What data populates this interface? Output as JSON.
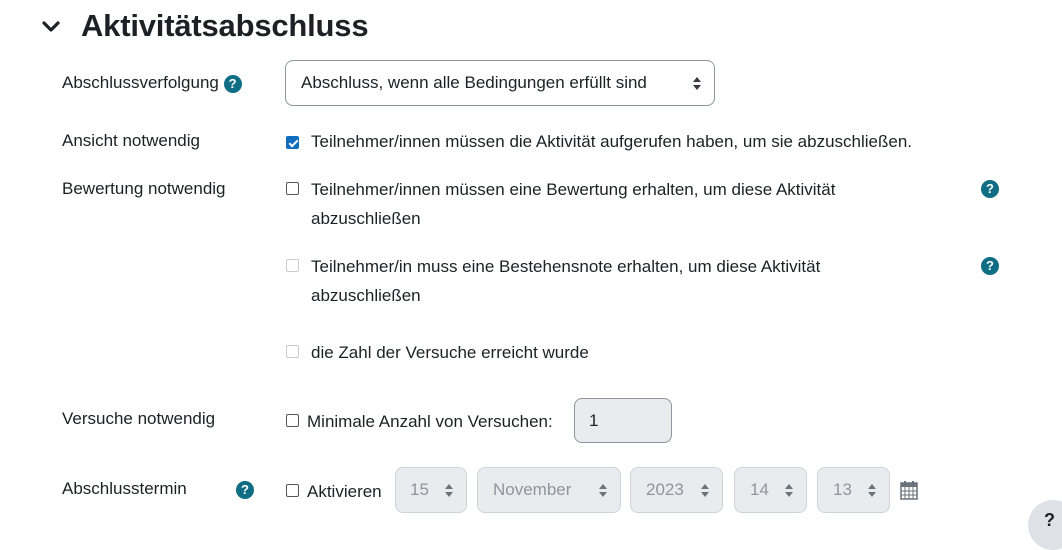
{
  "section": {
    "title": "Aktivitätsabschluss",
    "collapse_icon": "chevron-down-icon"
  },
  "completion_tracking": {
    "label": "Abschlussverfolgung",
    "help_icon": "question-circle-icon",
    "selected": "Abschluss, wenn alle Bedingungen erfüllt sind"
  },
  "view_required": {
    "label": "Ansicht notwendig",
    "checked": true,
    "text": "Teilnehmer/innen müssen die Aktivität aufgerufen haben, um sie abzuschließen."
  },
  "grade_required": {
    "label": "Bewertung notwendig",
    "options": [
      {
        "line1": "Teilnehmer/innen müssen eine Bewertung erhalten, um diese Aktivität",
        "line2": "abzuschließen",
        "checked": false,
        "disabled": false
      },
      {
        "line1": "Teilnehmer/in muss eine Bestehensnote erhalten, um diese Aktivität",
        "line2": "abzuschließen",
        "checked": false,
        "disabled": true
      },
      {
        "line1": "die Zahl der Versuche erreicht wurde",
        "checked": false,
        "disabled": true
      }
    ]
  },
  "attempts_required": {
    "label": "Versuche notwendig",
    "checkbox_label": "Minimale Anzahl von Versuchen:",
    "checked": false,
    "value": "1"
  },
  "completion_date": {
    "label": "Abschlusstermin",
    "enable_label": "Aktivieren",
    "checked": false,
    "day": "15",
    "month": "November",
    "year": "2023",
    "hour": "14",
    "minute": "13",
    "calendar_icon": "calendar-icon"
  },
  "floating_help": {
    "label": "?"
  }
}
